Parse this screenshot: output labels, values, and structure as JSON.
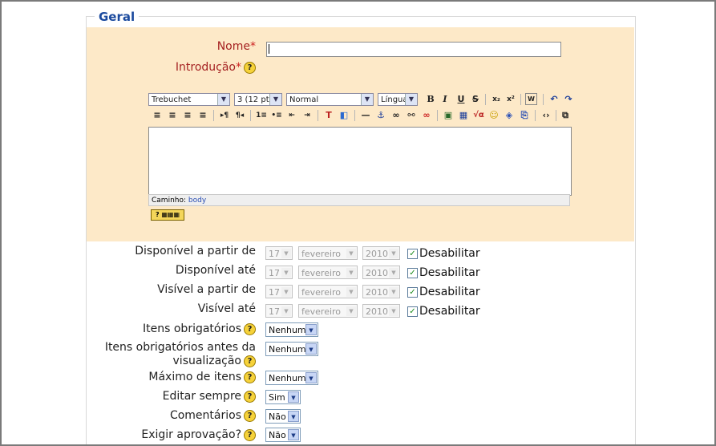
{
  "section": {
    "legend": "Geral"
  },
  "name_field": {
    "label": "Nome",
    "required_mark": "*",
    "value": ""
  },
  "intro_field": {
    "label": "Introdução",
    "required_mark": "*",
    "help": "?"
  },
  "editor": {
    "font": "Trebuchet",
    "size": "3 (12 pt)",
    "format": "Normal",
    "language": "Língua",
    "path_label": "Caminho:",
    "path_value": "body",
    "keyboard_help": "?"
  },
  "dates": [
    {
      "label": "Disponível a partir de",
      "day": "17",
      "month": "fevereiro",
      "year": "2010",
      "disable_label": "Desabilitar",
      "disabled": true
    },
    {
      "label": "Disponível até",
      "day": "17",
      "month": "fevereiro",
      "year": "2010",
      "disable_label": "Desabilitar",
      "disabled": true
    },
    {
      "label": "Visível a partir de",
      "day": "17",
      "month": "fevereiro",
      "year": "2010",
      "disable_label": "Desabilitar",
      "disabled": true
    },
    {
      "label": "Visível até",
      "day": "17",
      "month": "fevereiro",
      "year": "2010",
      "disable_label": "Desabilitar",
      "disabled": true
    }
  ],
  "settings": [
    {
      "label": "Itens obrigatórios",
      "value": "Nenhum"
    },
    {
      "label": "Itens obrigatórios antes da",
      "label2": "visualização",
      "value": "Nenhum"
    },
    {
      "label": "Máximo de itens",
      "value": "Nenhum"
    },
    {
      "label": "Editar sempre",
      "value": "Sim"
    },
    {
      "label": "Comentários",
      "value": "Não"
    },
    {
      "label": "Exigir aprovação?",
      "value": "Não"
    }
  ],
  "help_glyph": "?",
  "dropdown_glyph": "▼",
  "check_glyph": "✓"
}
